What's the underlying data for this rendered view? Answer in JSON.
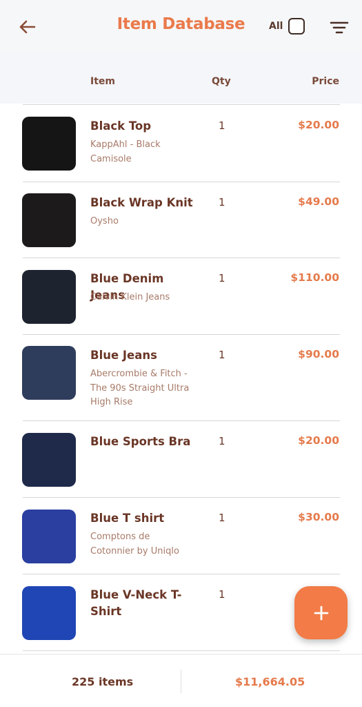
{
  "header": {
    "title": "Item Database",
    "all_label": "All",
    "back_icon": "arrow-left-icon",
    "filter_icon": "filter-lines-icon"
  },
  "columns": {
    "item": "Item",
    "qty": "Qty",
    "price": "Price"
  },
  "items": [
    {
      "name": "Black Top",
      "brand": "KappAhl - Black Camisole",
      "qty": "1",
      "price": "$20.00",
      "color": "#151515"
    },
    {
      "name": "Black Wrap Knit",
      "brand": "Oysho",
      "qty": "1",
      "price": "$49.00",
      "color": "#1c1a1a"
    },
    {
      "name": "Blue Denim Jeans",
      "brand": "Calvin Klein Jeans",
      "qty": "1",
      "price": "$110.00",
      "color": "#1e2330"
    },
    {
      "name": "Blue Jeans",
      "brand": "Abercrombie & Fitch - The 90s Straight Ultra High Rise",
      "qty": "1",
      "price": "$90.00",
      "color": "#2f3d5c"
    },
    {
      "name": "Blue Sports Bra",
      "brand": "",
      "qty": "1",
      "price": "$20.00",
      "color": "#1f2a4a"
    },
    {
      "name": "Blue T shirt",
      "brand": "Comptons de Cotonnier by Uniqlo",
      "qty": "1",
      "price": "$30.00",
      "color": "#2a3fa0"
    },
    {
      "name": "Blue V-Neck T-Shirt",
      "brand": "",
      "qty": "1",
      "price": "",
      "color": "#1f46b4"
    }
  ],
  "fab": {
    "icon": "plus-icon"
  },
  "footer": {
    "count": "225 items",
    "total": "$11,664.05"
  },
  "colors": {
    "accent": "#f27b47",
    "title": "#ea7a4b",
    "text": "#6a3626"
  }
}
